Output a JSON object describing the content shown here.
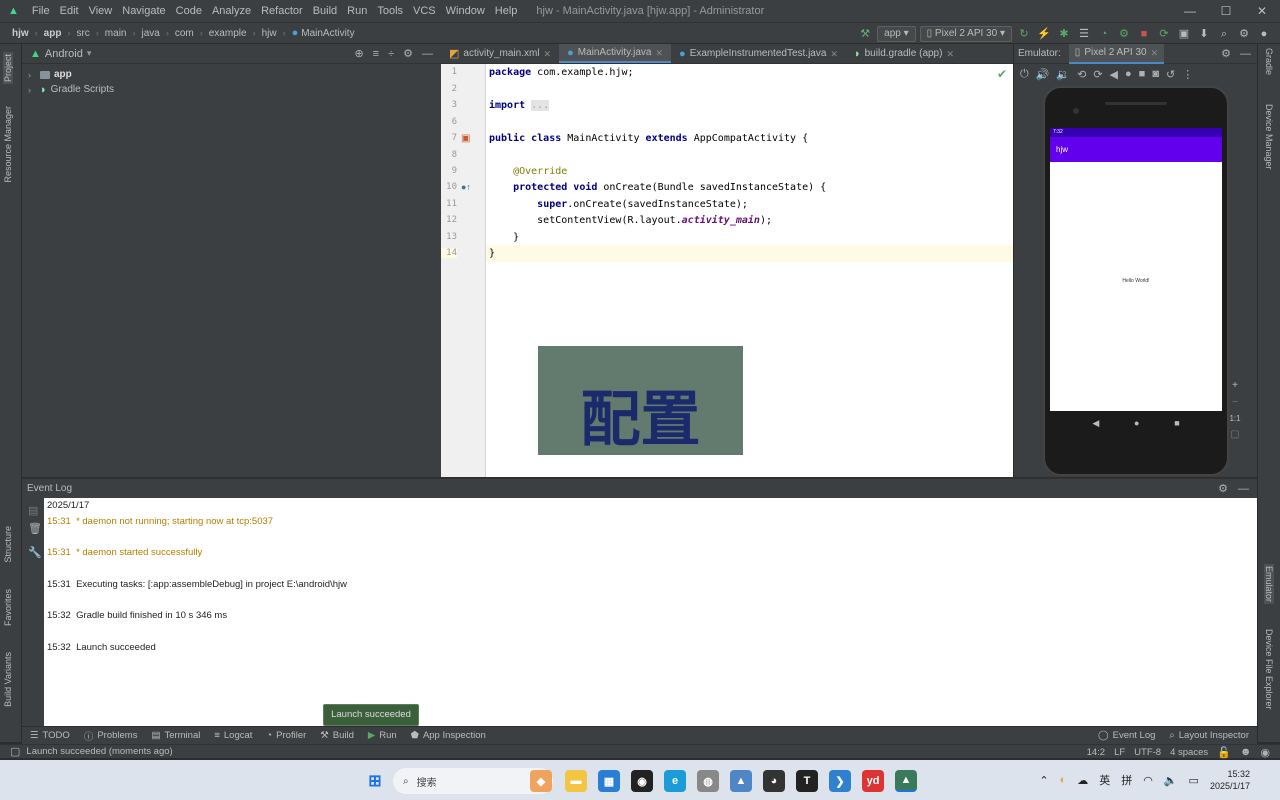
{
  "menu": [
    "File",
    "Edit",
    "View",
    "Navigate",
    "Code",
    "Analyze",
    "Refactor",
    "Build",
    "Run",
    "Tools",
    "VCS",
    "Window",
    "Help"
  ],
  "window_title": "hjw - MainActivity.java [hjw.app] - Administrator",
  "breadcrumbs": [
    "hjw",
    "app",
    "src",
    "main",
    "java",
    "com",
    "example",
    "hjw",
    "MainActivity"
  ],
  "run_config": "app",
  "device": "Pixel 2 API 30",
  "left_tabs": [
    "Project",
    "Resource Manager",
    "Structure",
    "Favorites",
    "Build Variants"
  ],
  "project_view": "Android",
  "tree": [
    "app",
    "Gradle Scripts"
  ],
  "editor_tabs": [
    "activity_main.xml",
    "MainActivity.java",
    "ExampleInstrumentedTest.java",
    "build.gradle (app)"
  ],
  "code_lines": [
    {
      "n": "1",
      "html": "<span class='kw'>package</span> com.example.hjw;"
    },
    {
      "n": "2",
      "html": ""
    },
    {
      "n": "3",
      "html": "<span class='kw'>import</span> <span class='fold'>...</span>"
    },
    {
      "n": "6",
      "html": ""
    },
    {
      "n": "7",
      "html": "<span class='kw'>public class</span> MainActivity <span class='kw'>extends</span> AppCompatActivity {"
    },
    {
      "n": "8",
      "html": ""
    },
    {
      "n": "9",
      "html": "    <span class='ann'>@Override</span>"
    },
    {
      "n": "10",
      "html": "    <span class='kw'>protected void</span> onCreate(Bundle savedInstanceState) {"
    },
    {
      "n": "11",
      "html": "        <span class='kw'>super</span>.onCreate(savedInstanceState);"
    },
    {
      "n": "12",
      "html": "        setContentView(R.layout.<span class='it'>activity_main</span>);"
    },
    {
      "n": "13",
      "html": "    }"
    },
    {
      "n": "14",
      "html": "}"
    }
  ],
  "overlay_text": "配置",
  "emulator": {
    "label": "Emulator:",
    "tab": "Pixel 2 API 30",
    "app_title": "hjw",
    "hello_text": "Hello World!",
    "status_time": "7:32",
    "zoom_ratio": "1:1"
  },
  "right_tabs": [
    "Gradle",
    "Device Manager",
    "Emulator",
    "Device File Explorer"
  ],
  "event_log": {
    "title": "Event Log",
    "date": "2025/1/17",
    "lines": [
      {
        "time": "15:31",
        "text": "* daemon not running; starting now at tcp:5037",
        "warn": true
      },
      {
        "time": "15:31",
        "text": "* daemon started successfully",
        "warn": true
      },
      {
        "time": "15:31",
        "text": "Executing tasks: [:app:assembleDebug] in project E:\\android\\hjw",
        "warn": false
      },
      {
        "time": "15:32",
        "text": "Gradle build finished in 10 s 346 ms",
        "warn": false
      },
      {
        "time": "15:32",
        "text": "Launch succeeded",
        "warn": false
      }
    ]
  },
  "toast": "Launch succeeded",
  "bottom_tabs": [
    "TODO",
    "Problems",
    "Terminal",
    "Logcat",
    "Profiler",
    "Build",
    "Run",
    "App Inspection"
  ],
  "bottom_tabs_right": [
    "Event Log",
    "Layout Inspector"
  ],
  "status": {
    "message": "Launch succeeded (moments ago)",
    "position": "14:2",
    "line_sep": "LF",
    "encoding": "UTF-8",
    "indent": "4 spaces"
  },
  "taskbar": {
    "search": "搜索",
    "ime1": "英",
    "ime2": "拼",
    "time": "15:32",
    "date": "2025/1/17"
  }
}
